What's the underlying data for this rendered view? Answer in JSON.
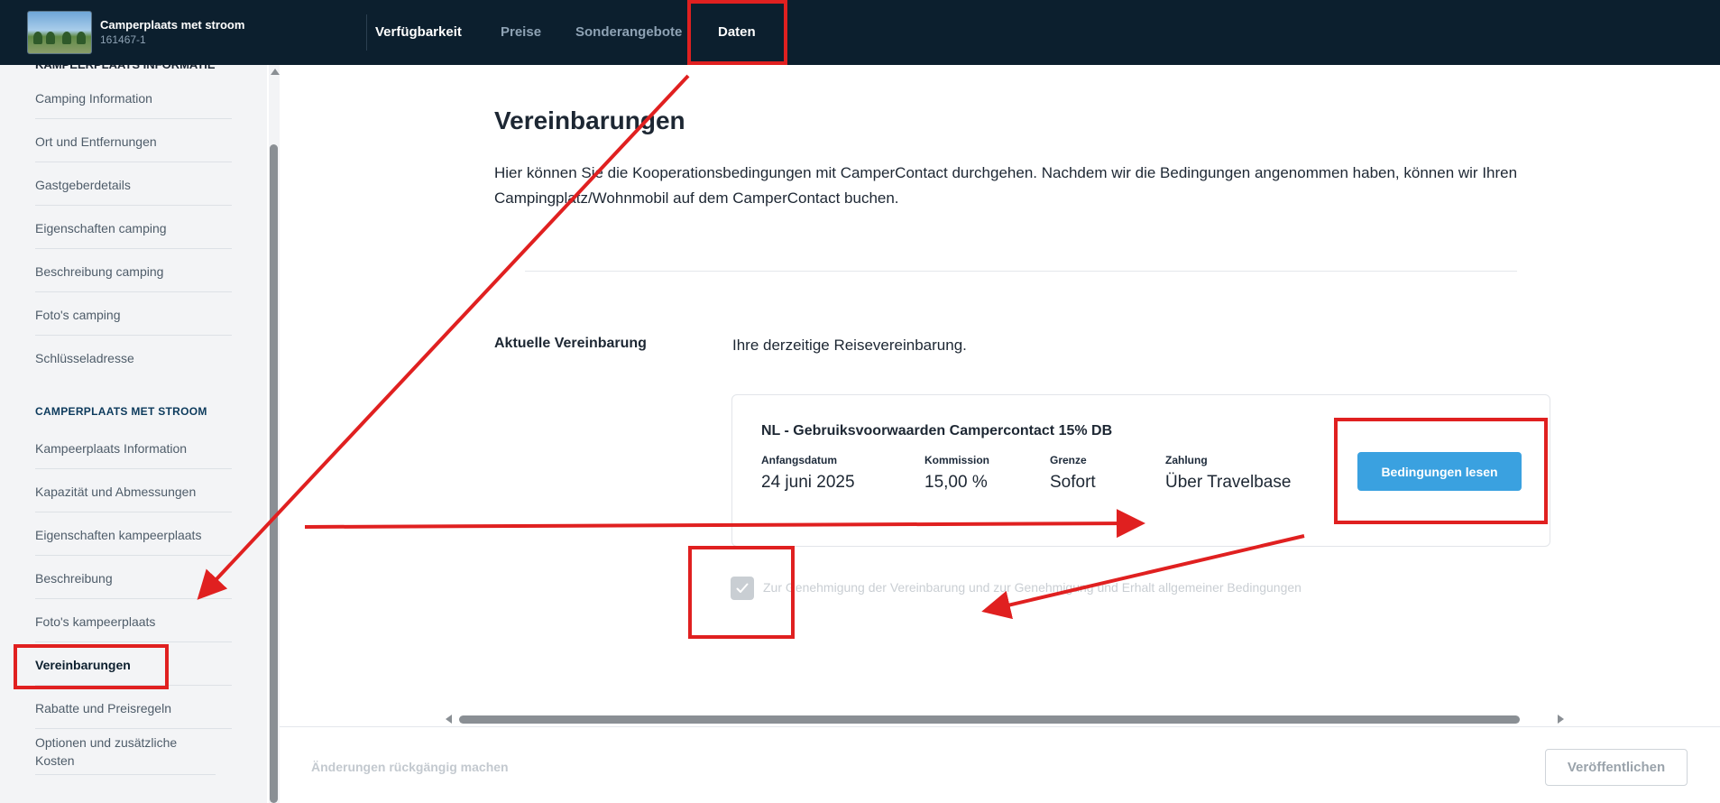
{
  "header": {
    "site_title": "Camperplaats met stroom",
    "site_id": "161467-1",
    "nav": [
      {
        "label": "Verfügbarkeit"
      },
      {
        "label": "Preise"
      },
      {
        "label": "Sonderangebote"
      },
      {
        "label": "Daten"
      }
    ]
  },
  "sidebar": {
    "items_top": [
      {
        "label": "Camping Information"
      },
      {
        "label": "Ort und Entfernungen"
      },
      {
        "label": "Gastgeberdetails"
      },
      {
        "label": "Eigenschaften camping"
      },
      {
        "label": "Beschreibung camping"
      },
      {
        "label": "Foto's camping"
      },
      {
        "label": "Schlüsseladresse"
      }
    ],
    "section_heading": "CAMPERPLAATS MET STROOM",
    "items_bottom": [
      {
        "label": "Kampeerplaats Information"
      },
      {
        "label": "Kapazität und Abmessungen"
      },
      {
        "label": "Eigenschaften kampeerplaats"
      },
      {
        "label": "Beschreibung"
      },
      {
        "label": "Foto's kampeerplaats"
      },
      {
        "label": "Vereinbarungen"
      },
      {
        "label": "Rabatte und Preisregeln"
      },
      {
        "label": "Optionen und zusätzliche Kosten"
      }
    ]
  },
  "main": {
    "title": "Vereinbarungen",
    "intro": "Hier können Sie die Kooperationsbedingungen mit CamperContact durchgehen. Nachdem wir die Bedingungen angenommen haben, können wir Ihren Campingplatz/Wohnmobil auf dem CamperContact buchen.",
    "current_label": "Aktuelle Vereinbarung",
    "current_text": "Ihre derzeitige Reisevereinbarung.",
    "agreement": {
      "title": "NL - Gebruiksvoorwaarden Campercontact 15% DB",
      "fields": [
        {
          "label": "Anfangsdatum",
          "value": "24 juni 2025"
        },
        {
          "label": "Kommission",
          "value": "15,00 %"
        },
        {
          "label": "Grenze",
          "value": "Sofort"
        },
        {
          "label": "Zahlung",
          "value": "Über Travelbase"
        }
      ],
      "button_label": "Bedingungen lesen"
    },
    "consent_label": "Zur Genehmigung der Vereinbarung und zur Genehmigung und Erhalt allgemeiner Bedingungen",
    "consent_checked": true
  },
  "footer": {
    "undo_label": "Änderungen rückgängig machen",
    "publish_label": "Veröffentlichen"
  },
  "colors": {
    "topbar": "#0c1f2e",
    "accent": "#3aa1e0",
    "annotation": "#e02020"
  }
}
